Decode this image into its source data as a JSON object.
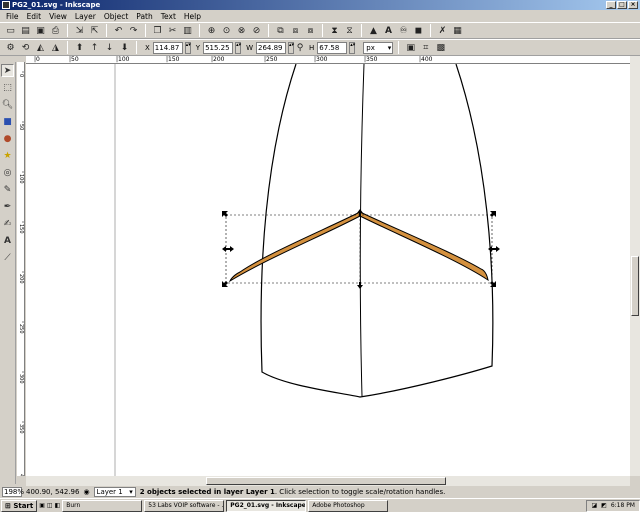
{
  "window": {
    "title": "PG2_01.svg - Inkscape"
  },
  "menu": [
    "File",
    "Edit",
    "View",
    "Layer",
    "Object",
    "Path",
    "Text",
    "Help"
  ],
  "selector_toolbar": {
    "x_label": "X",
    "x_value": "114.87",
    "y_label": "Y",
    "y_value": "515.25",
    "w_label": "W",
    "w_value": "264.89",
    "h_label": "H",
    "h_value": "67.58",
    "unit": "px"
  },
  "ruler_h_labels": [
    "|0",
    "|50",
    "|100",
    "|150",
    "|200",
    "|250",
    "|300",
    "|350",
    "|400"
  ],
  "ruler_v_labels": [
    "0",
    "50",
    "100",
    "150",
    "200",
    "250",
    "300",
    "350",
    "400"
  ],
  "status": {
    "zoom": "198%",
    "coords": "400.90, 542.96",
    "layer": "Layer 1",
    "message_pre": "2 objects selected in layer ",
    "message_layer": "Layer 1",
    "message_post": ". Click selection to toggle scale/rotation handles."
  },
  "taskbar": {
    "start": "Start",
    "tasks": [
      "Burn",
      "53 Labs VOIP software - ...",
      "PG2_01.svg - Inkscape",
      "Adobe Photoshop"
    ],
    "clock": "6:18 PM"
  },
  "colors": {
    "shape_fill": "#d4913f",
    "titlebar": "#0a246a"
  }
}
